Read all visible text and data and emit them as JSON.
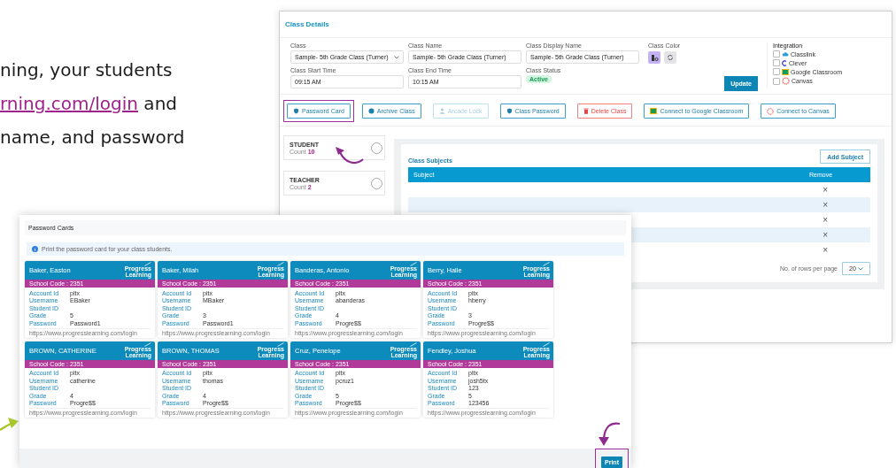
{
  "intro": {
    "line_1": "ning, your students",
    "link": "rning.com/login",
    "line_2_rest": "and",
    "line_3": "name, and password"
  },
  "class_details": {
    "title": "Class Details",
    "fields": [
      {
        "label": "Class",
        "value": "Sample- 5th Grade Class (Turner)",
        "kind": "select"
      },
      {
        "label": "Class Name",
        "value": "Sample- 5th Grade Class (Turner)",
        "kind": "input"
      },
      {
        "label": "Class Display Name",
        "value": "Sample- 5th Grade Class (Turner)",
        "kind": "input"
      },
      {
        "label": "Class Start Time",
        "value": "09:15 AM",
        "kind": "input"
      },
      {
        "label": "Class End Time",
        "value": "10:15 AM",
        "kind": "input"
      },
      {
        "label": "Class Status",
        "value": "Active",
        "kind": "badge"
      }
    ],
    "class_color_label": "Class Color",
    "integration": {
      "label": "Integration",
      "items": [
        {
          "label": "Classlink",
          "checked": false
        },
        {
          "label": "Clever",
          "checked": false
        },
        {
          "label": "Google Classroom",
          "checked": false
        },
        {
          "label": "Canvas",
          "checked": false
        }
      ]
    },
    "update_button": "Update",
    "actions": [
      {
        "label": "Password Card",
        "kind": "normal",
        "disabled": false,
        "highlighted": true
      },
      {
        "label": "Archive Class",
        "kind": "normal",
        "disabled": false,
        "highlighted": false
      },
      {
        "label": "Arcade Lock",
        "kind": "normal",
        "disabled": true,
        "highlighted": false
      },
      {
        "label": "Class Password",
        "kind": "normal",
        "disabled": false,
        "highlighted": false
      },
      {
        "label": "Delete Class",
        "kind": "danger",
        "disabled": false,
        "highlighted": false
      },
      {
        "label": "Connect to Google Classroom",
        "kind": "normal",
        "disabled": false,
        "highlighted": false
      },
      {
        "label": "Connect to Canvas",
        "kind": "normal",
        "disabled": false,
        "highlighted": false
      }
    ],
    "roles": [
      {
        "label": "STUDENT",
        "count_label": "Count",
        "count": "10",
        "selected": false
      },
      {
        "label": "TEACHER",
        "count_label": "Count",
        "count": "2",
        "selected": false
      }
    ],
    "subjects": {
      "title": "Class Subjects",
      "add_button": "Add Subject",
      "columns": [
        "Subject",
        "Remove"
      ],
      "rows": [
        {
          "remove": "×"
        },
        {
          "remove": "×"
        },
        {
          "remove": "×"
        },
        {
          "remove": "×"
        },
        {
          "remove": "×"
        }
      ],
      "rows_per_page_label": "No. of rows per page",
      "rows_per_page": "20"
    }
  },
  "password_cards": {
    "title": "Password Cards",
    "info": "Print the password card for your class students.",
    "cards": [
      {
        "name": "Baker, Easton",
        "logo": "Progress Learning",
        "school_code": "School Code : 2351",
        "fields": [
          {
            "label": "Account Id",
            "value": "pltx"
          },
          {
            "label": "Username",
            "value": "EBaker"
          },
          {
            "label": "Student ID"
          },
          {
            "label": "Grade",
            "value": "5"
          },
          {
            "label": "Password",
            "value": "Password1"
          }
        ],
        "url": "https://www.progresslearning.com/login"
      },
      {
        "name": "Baker, Milah",
        "logo": "Progress Learning",
        "school_code": "School Code : 2351",
        "fields": [
          {
            "label": "Account Id",
            "value": "pltx"
          },
          {
            "label": "Username",
            "value": "MBaker"
          },
          {
            "label": "Student ID"
          },
          {
            "label": "Grade",
            "value": "3"
          },
          {
            "label": "Password",
            "value": "Password1"
          }
        ],
        "url": "https://www.progresslearning.com/login"
      },
      {
        "name": "Banderas, Antonio",
        "logo": "Progress Learning",
        "school_code": "School Code : 2351",
        "fields": [
          {
            "label": "Account Id",
            "value": "pltx"
          },
          {
            "label": "Username",
            "value": "abanderas"
          },
          {
            "label": "Student ID"
          },
          {
            "label": "Grade",
            "value": "4"
          },
          {
            "label": "Password",
            "value": "Progre$$"
          }
        ],
        "url": "https://www.progresslearning.com/login"
      },
      {
        "name": "Berry, Halle",
        "logo": "Progress Learning",
        "school_code": "School Code : 2351",
        "fields": [
          {
            "label": "Account Id",
            "value": "pltx"
          },
          {
            "label": "Username",
            "value": "hberry"
          },
          {
            "label": "Student ID"
          },
          {
            "label": "Grade",
            "value": "3"
          },
          {
            "label": "Password",
            "value": "Progre$$"
          }
        ],
        "url": "https://www.progresslearning.com/login"
      },
      {
        "name": "BROWN, CATHERINE",
        "logo": "Progress Learning",
        "school_code": "School Code : 2351",
        "fields": [
          {
            "label": "Account Id",
            "value": "pltx"
          },
          {
            "label": "Username",
            "value": "catherine"
          },
          {
            "label": "Student ID"
          },
          {
            "label": "Grade",
            "value": "4"
          },
          {
            "label": "Password",
            "value": "Progre$$"
          }
        ],
        "url": "https://www.progresslearning.com/login"
      },
      {
        "name": "BROWN, THOMAS",
        "logo": "Progress Learning",
        "school_code": "School Code : 2351",
        "fields": [
          {
            "label": "Account Id",
            "value": "pltx"
          },
          {
            "label": "Username",
            "value": "thomas"
          },
          {
            "label": "Student ID"
          },
          {
            "label": "Grade",
            "value": "4"
          },
          {
            "label": "Password",
            "value": "Progre$$"
          }
        ],
        "url": "https://www.progresslearning.com/login"
      },
      {
        "name": "Cruz, Penelope",
        "logo": "Progress Learning",
        "school_code": "School Code : 2351",
        "fields": [
          {
            "label": "Account Id",
            "value": "pltx"
          },
          {
            "label": "Username",
            "value": "pcruz1"
          },
          {
            "label": "Student ID"
          },
          {
            "label": "Grade",
            "value": "5"
          },
          {
            "label": "Password",
            "value": "Progre$$"
          }
        ],
        "url": "https://www.progresslearning.com/login"
      },
      {
        "name": "Fendley, Joshua",
        "logo": "Progress Learning",
        "school_code": "School Code : 2351",
        "fields": [
          {
            "label": "Account Id",
            "value": "pltx"
          },
          {
            "label": "Username",
            "value": "josh5tx"
          },
          {
            "label": "Student ID",
            "value": "123"
          },
          {
            "label": "Grade",
            "value": "5"
          },
          {
            "label": "Password",
            "value": "123456"
          }
        ],
        "url": "https://www.progresslearning.com/login"
      }
    ],
    "print_button": {
      "label": "Print",
      "highlighted": true
    }
  }
}
